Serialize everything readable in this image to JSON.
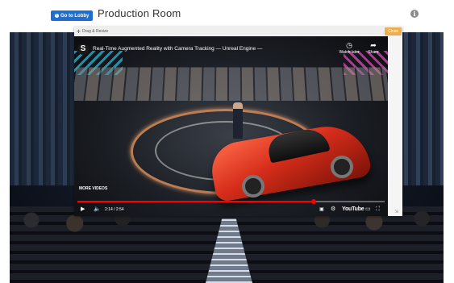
{
  "header": {
    "lobby_label": "Go to Lobby",
    "lobby_icon": "arrow-circle-left-icon",
    "title": "Production Room",
    "info_icon": "i"
  },
  "panel": {
    "drag_label": "Drag & Resize",
    "close_label": "Close"
  },
  "video": {
    "channel_logo": "S",
    "title": "Real-Time Augmented Reality with Camera Tracking — Unreal Engine —",
    "watch_later_label": "Watch later",
    "share_label": "Share",
    "more_videos_label": "MORE VIDEOS",
    "time": "2:14 / 2:54",
    "progress": 0.77,
    "youtube_label": "YouTube"
  },
  "colors": {
    "lobby_button": "#1f6fd0",
    "close_button": "#f0ad4e",
    "progress": "#ff0000"
  }
}
